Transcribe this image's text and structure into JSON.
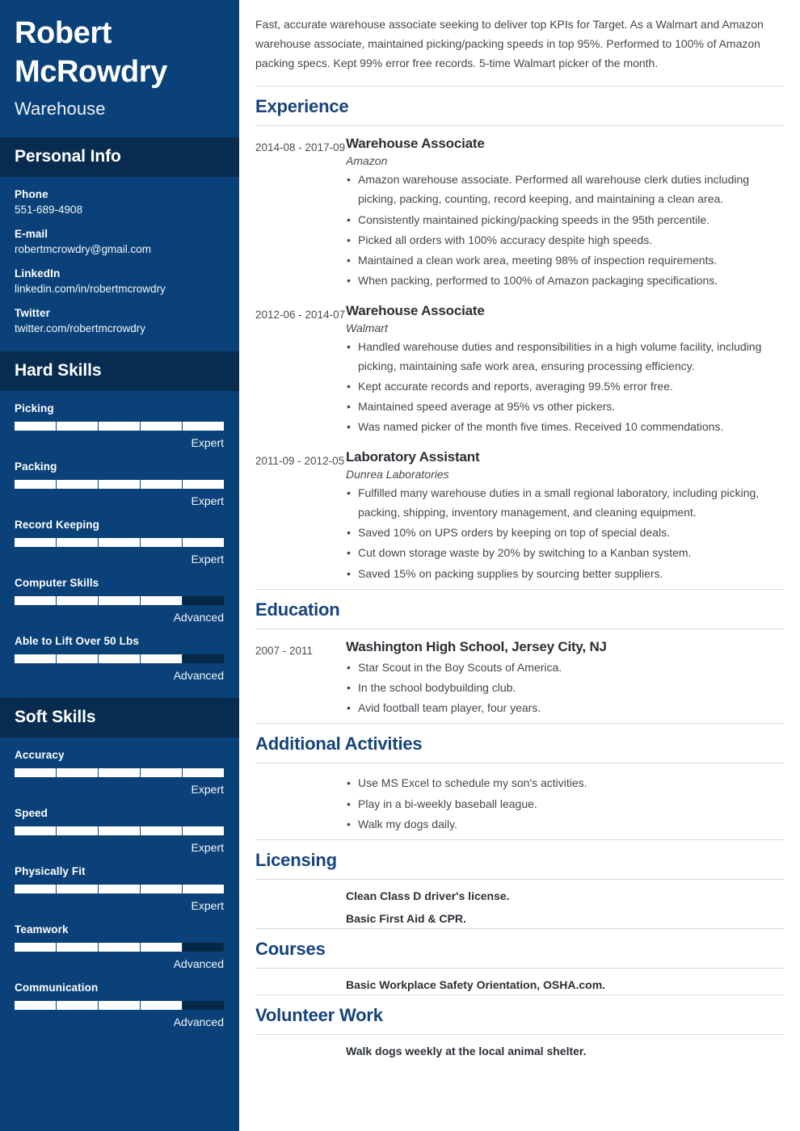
{
  "theme": {
    "sidebar_bg": "#0a4178",
    "sidebar_band_bg": "#082c50",
    "accent_heading": "#15447c",
    "bar_fill": "#ffffff",
    "bar_empty": "#062847"
  },
  "sidebar": {
    "name": "Robert McRowdry",
    "job_title": "Warehouse",
    "personal_info": {
      "heading": "Personal Info",
      "items": [
        {
          "label": "Phone",
          "value": "551-689-4908"
        },
        {
          "label": "E-mail",
          "value": "robertmcrowdry@gmail.com"
        },
        {
          "label": "LinkedIn",
          "value": "linkedin.com/in/robertmcrowdry"
        },
        {
          "label": "Twitter",
          "value": "twitter.com/robertmcrowdry"
        }
      ]
    },
    "hard_skills": {
      "heading": "Hard Skills",
      "items": [
        {
          "name": "Picking",
          "level": "Expert",
          "segments_filled": 5,
          "segments_total": 5
        },
        {
          "name": "Packing",
          "level": "Expert",
          "segments_filled": 5,
          "segments_total": 5
        },
        {
          "name": "Record Keeping",
          "level": "Expert",
          "segments_filled": 5,
          "segments_total": 5
        },
        {
          "name": "Computer Skills",
          "level": "Advanced",
          "segments_filled": 4,
          "segments_total": 5
        },
        {
          "name": "Able to Lift Over 50 Lbs",
          "level": "Advanced",
          "segments_filled": 4,
          "segments_total": 5
        }
      ]
    },
    "soft_skills": {
      "heading": "Soft Skills",
      "items": [
        {
          "name": "Accuracy",
          "level": "Expert",
          "segments_filled": 5,
          "segments_total": 5
        },
        {
          "name": "Speed",
          "level": "Expert",
          "segments_filled": 5,
          "segments_total": 5
        },
        {
          "name": "Physically Fit",
          "level": "Expert",
          "segments_filled": 5,
          "segments_total": 5
        },
        {
          "name": "Teamwork",
          "level": "Advanced",
          "segments_filled": 4,
          "segments_total": 5
        },
        {
          "name": "Communication",
          "level": "Advanced",
          "segments_filled": 4,
          "segments_total": 5
        }
      ]
    }
  },
  "main": {
    "summary": "Fast, accurate warehouse associate seeking to deliver top KPIs for Target. As a Walmart and Amazon warehouse associate, maintained picking/packing speeds in top 95%. Performed to 100% of Amazon packing specs. Kept 99% error free records. 5-time Walmart picker of the month.",
    "experience": {
      "heading": "Experience",
      "entries": [
        {
          "dates": "2014-08 - 2017-09",
          "role": "Warehouse Associate",
          "org": "Amazon",
          "bullets": [
            "Amazon warehouse associate. Performed all warehouse clerk duties including picking, packing, counting, record keeping, and maintaining a clean area.",
            "Consistently maintained picking/packing speeds in the 95th percentile.",
            "Picked all orders with 100% accuracy despite high speeds.",
            "Maintained a clean work area, meeting 98% of inspection requirements.",
            "When packing, performed to 100% of Amazon packaging specifications."
          ]
        },
        {
          "dates": "2012-06 - 2014-07",
          "role": "Warehouse Associate",
          "org": "Walmart",
          "bullets": [
            "Handled warehouse duties and responsibilities in a high volume facility, including picking, maintaining safe work area, ensuring processing efficiency.",
            "Kept accurate records and reports, averaging 99.5% error free.",
            "Maintained speed average at 95% vs other pickers.",
            "Was named picker of the month five times. Received 10 commendations."
          ]
        },
        {
          "dates": "2011-09 - 2012-05",
          "role": "Laboratory Assistant",
          "org": "Dunrea Laboratories",
          "bullets": [
            "Fulfilled many warehouse duties in a small regional laboratory, including picking, packing, shipping, inventory management, and cleaning equipment.",
            "Saved 10% on UPS orders by keeping on top of special deals.",
            "Cut down storage waste by 20% by switching to a Kanban system.",
            "Saved 15% on packing supplies by sourcing better suppliers."
          ]
        }
      ]
    },
    "education": {
      "heading": "Education",
      "entries": [
        {
          "dates": "2007 - 2011",
          "role": "Washington High School, Jersey City, NJ",
          "org": "",
          "bullets": [
            "Star Scout in the Boy Scouts of America.",
            "In the school bodybuilding club.",
            "Avid football team player, four years."
          ]
        }
      ]
    },
    "additional_activities": {
      "heading": "Additional Activities",
      "bullets": [
        "Use MS Excel to schedule my son's activities.",
        "Play in a bi-weekly baseball league.",
        "Walk my dogs daily."
      ]
    },
    "licensing": {
      "heading": "Licensing",
      "entries": [
        "Clean Class D driver's license.",
        "Basic First Aid & CPR."
      ]
    },
    "courses": {
      "heading": "Courses",
      "entries": [
        "Basic Workplace Safety Orientation, OSHA.com."
      ]
    },
    "volunteer_work": {
      "heading": "Volunteer Work",
      "entries": [
        "Walk dogs weekly at the local animal shelter."
      ]
    }
  }
}
